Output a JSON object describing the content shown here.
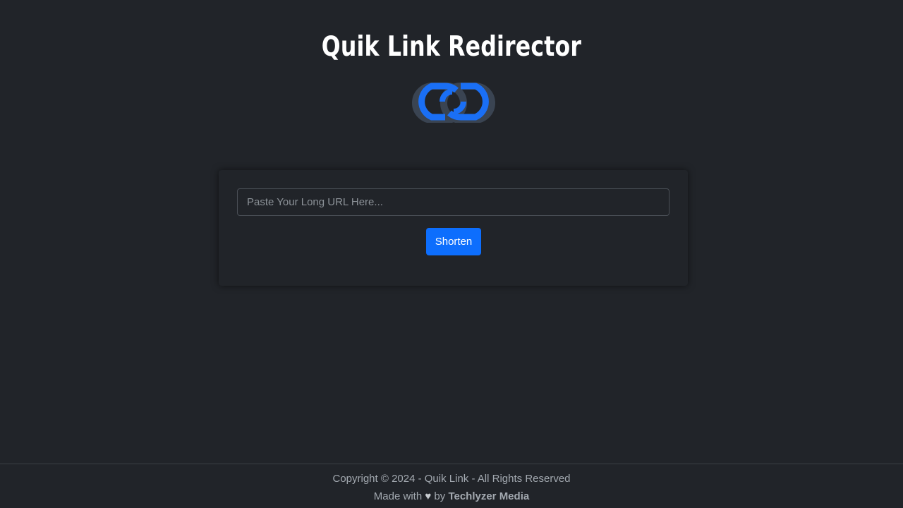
{
  "header": {
    "title": "Quik Link Redirector",
    "logo_icon": "link-chain-icon",
    "accent_color": "#0d6efd"
  },
  "form": {
    "url_placeholder": "Paste Your Long URL Here...",
    "url_value": "",
    "submit_label": "Shorten"
  },
  "footer": {
    "copyright": "Copyright © 2024 - Quik Link - All Rights Reserved",
    "made_with": "Made with",
    "heart": "♥",
    "by": "by",
    "brand": "Techlyzer Media"
  }
}
